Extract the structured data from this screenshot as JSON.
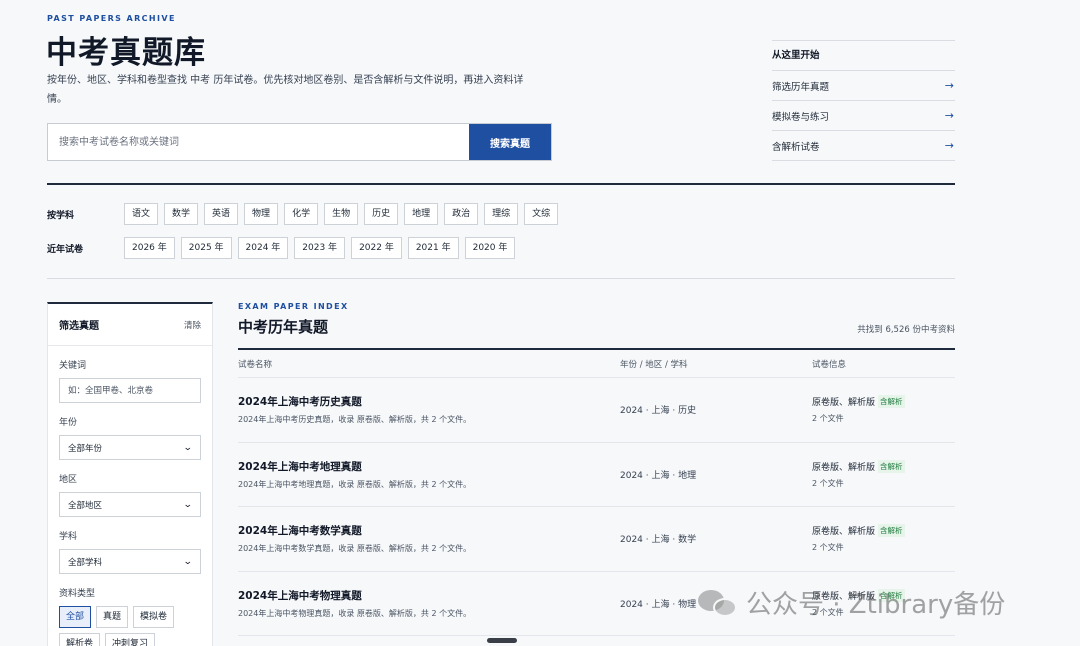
{
  "header": {
    "eyebrow": "PAST PAPERS ARCHIVE",
    "title": "中考真题库",
    "description": "按年份、地区、学科和卷型查找 中考 历年试卷。优先核对地区卷别、是否含解析与文件说明，再进入资料详情。"
  },
  "search": {
    "placeholder": "搜索中考试卷名称或关键词",
    "button_label": "搜索真题"
  },
  "quick_start": {
    "title": "从这里开始",
    "links": [
      {
        "label": "筛选历年真题",
        "icon": "arrow-right-icon"
      },
      {
        "label": "模拟卷与练习",
        "icon": "arrow-right-icon"
      },
      {
        "label": "含解析试卷",
        "icon": "arrow-right-icon"
      }
    ]
  },
  "subjects": {
    "label": "按学科",
    "items": [
      "语文",
      "数学",
      "英语",
      "物理",
      "化学",
      "生物",
      "历史",
      "地理",
      "政治",
      "理综",
      "文综"
    ]
  },
  "years": {
    "label": "近年试卷",
    "items": [
      "2026 年",
      "2025 年",
      "2024 年",
      "2023 年",
      "2022 年",
      "2021 年",
      "2020 年"
    ]
  },
  "filter_panel": {
    "title": "筛选真题",
    "clear_label": "清除",
    "keyword_label": "关键词",
    "keyword_placeholder": "如：全国甲卷、北京卷",
    "year_label": "年份",
    "year_value": "全部年份",
    "region_label": "地区",
    "region_value": "全部地区",
    "subject_label": "学科",
    "subject_value": "全部学科",
    "type_label": "资料类型",
    "types": [
      "全部",
      "真题",
      "模拟卷",
      "解析卷",
      "冲刺复习"
    ],
    "active_type": "全部"
  },
  "results": {
    "eyebrow": "EXAM PAPER INDEX",
    "title": "中考历年真题",
    "count_text": "共找到 6,526 份中考资料",
    "columns": [
      "试卷名称",
      "年份 / 地区 / 学科",
      "试卷信息"
    ],
    "rows": [
      {
        "title": "2024年上海中考历史真题",
        "desc": "2024年上海中考历史真题，收录 原卷版、解析版，共 2 个文件。",
        "meta": "2024 · 上海 · 历史",
        "info": "原卷版、解析版",
        "badge": "含解析",
        "files": "2 个文件"
      },
      {
        "title": "2024年上海中考地理真题",
        "desc": "2024年上海中考地理真题，收录 原卷版、解析版，共 2 个文件。",
        "meta": "2024 · 上海 · 地理",
        "info": "原卷版、解析版",
        "badge": "含解析",
        "files": "2 个文件"
      },
      {
        "title": "2024年上海中考数学真题",
        "desc": "2024年上海中考数学真题，收录 原卷版、解析版，共 2 个文件。",
        "meta": "2024 · 上海 · 数学",
        "info": "原卷版、解析版",
        "badge": "含解析",
        "files": "2 个文件"
      },
      {
        "title": "2024年上海中考物理真题",
        "desc": "2024年上海中考物理真题，收录 原卷版、解析版，共 2 个文件。",
        "meta": "2024 · 上海 · 物理",
        "info": "原卷版、解析版",
        "badge": "含解析",
        "files": "2 个文件"
      }
    ]
  },
  "watermark": {
    "text": "公众号 · Ztibrary备份",
    "icon": "wechat-icon"
  },
  "colors": {
    "accent": "#1f4fa0",
    "badge_green": "#1b7a3a",
    "rule_dark": "#1f2a3d",
    "background": "#f6f8fa"
  }
}
